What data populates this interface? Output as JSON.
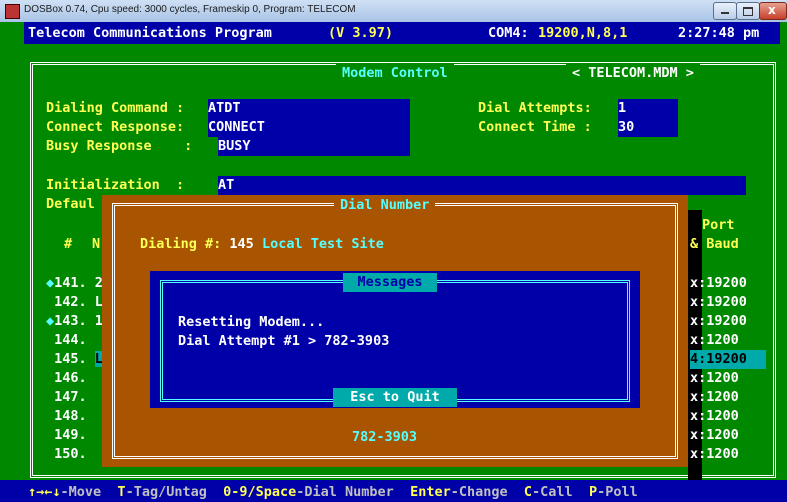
{
  "window": {
    "title": "DOSBox 0.74, Cpu speed:   3000 cycles, Frameskip  0, Program:  TELECOM"
  },
  "header": {
    "app": "Telecom Communications Program",
    "version": "(V 3.97)",
    "port": "COM4:",
    "settings": "19200,N,8,1",
    "time": "2:27:48 pm"
  },
  "panel": {
    "title": "Modem Control",
    "file": "< TELECOM.MDM >"
  },
  "fields": {
    "dialing_command": {
      "label": "Dialing Command :",
      "value": "ATDT"
    },
    "connect_response": {
      "label": "Connect Response:",
      "value": "CONNECT"
    },
    "busy_response": {
      "label": "Busy Response    :",
      "value": "BUSY"
    },
    "dial_attempts": {
      "label": "Dial Attempts:",
      "value": "1"
    },
    "connect_time": {
      "label": "Connect Time :",
      "value": "30"
    },
    "initialization": {
      "label": "Initialization  :",
      "value": "AT"
    },
    "default_partial": "Defaul"
  },
  "table": {
    "col_num": "#",
    "col_name_partial": "N",
    "col_port_top": "Port",
    "col_port_bottom": "& Baud",
    "rows": [
      {
        "num": "141.",
        "mark": "◆",
        "partial": "2",
        "baud": "x:19200",
        "selected": false
      },
      {
        "num": "142.",
        "mark": " ",
        "partial": "L",
        "baud": "x:19200",
        "selected": false
      },
      {
        "num": "143.",
        "mark": "◆",
        "partial": "1",
        "baud": "x:19200",
        "selected": false
      },
      {
        "num": "144.",
        "mark": " ",
        "partial": "",
        "baud": "x:1200",
        "selected": false
      },
      {
        "num": "145.",
        "mark": " ",
        "partial": "L",
        "baud": "4:19200",
        "selected": true
      },
      {
        "num": "146.",
        "mark": " ",
        "partial": "",
        "baud": "x:1200",
        "selected": false
      },
      {
        "num": "147.",
        "mark": " ",
        "partial": "",
        "baud": "x:1200",
        "selected": false
      },
      {
        "num": "148.",
        "mark": " ",
        "partial": "",
        "baud": "x:1200",
        "selected": false
      },
      {
        "num": "149.",
        "mark": " ",
        "partial": "",
        "baud": "x:1200",
        "selected": false
      },
      {
        "num": "150.",
        "mark": " ",
        "partial": "",
        "baud": "x:1200",
        "selected": false
      }
    ]
  },
  "dial_dialog": {
    "title": "Dial Number",
    "dialing_label": "Dialing #:",
    "dialing_number": "145",
    "dialing_name": "Local Test Site",
    "messages_title": "Messages",
    "message_lines": [
      "Resetting Modem...",
      "Dial Attempt #1 > 782-3903"
    ],
    "esc_label": "Esc to Quit",
    "phone": "782-3903"
  },
  "statusbar": [
    {
      "key": "↑→←↓",
      "desc": "-Move"
    },
    {
      "key": "T",
      "desc": "-Tag/Untag"
    },
    {
      "key": "0-9/Space",
      "desc": "-Dial Number"
    },
    {
      "key": "Enter",
      "desc": "-Change"
    },
    {
      "key": "C",
      "desc": "-Call"
    },
    {
      "key": "P",
      "desc": "-Poll"
    }
  ],
  "colors": {
    "background": "#008800",
    "field": "#0000a8",
    "dialog": "#a85400",
    "dialog_bg": "#0000a8",
    "highlight": "#ffff55"
  }
}
